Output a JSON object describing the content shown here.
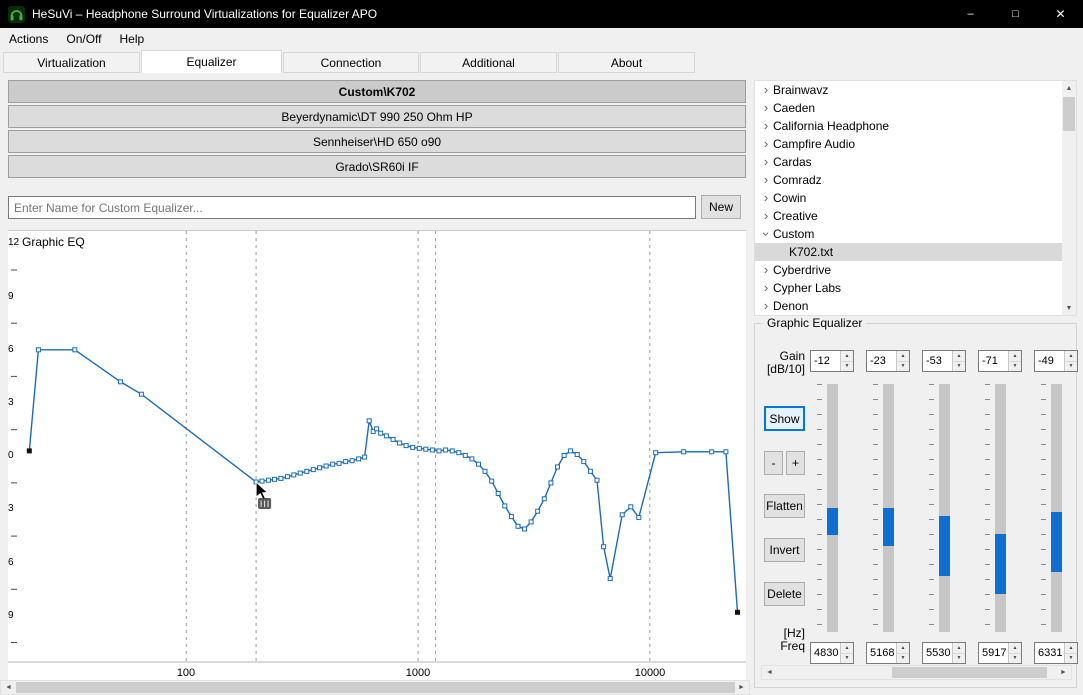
{
  "window": {
    "title": "HeSuVi – Headphone Surround Virtualizations for Equalizer APO"
  },
  "titlebar_controls": {
    "minimize": "–",
    "maximize": "□",
    "close": "✕"
  },
  "menu": [
    "Actions",
    "On/Off",
    "Help"
  ],
  "tabs": [
    "Virtualization",
    "Equalizer",
    "Connection",
    "Additional",
    "About"
  ],
  "active_tab": "Equalizer",
  "presets": [
    "Custom\\K702",
    "Beyerdynamic\\DT 990 250 Ohm HP",
    "Sennheiser\\HD 650 o90",
    "Grado\\SR60i IF"
  ],
  "selected_preset": "Custom\\K702",
  "name_input": {
    "placeholder": "Enter Name for Custom Equalizer...",
    "value": ""
  },
  "new_button_label": "New",
  "chart_data": {
    "type": "line",
    "title": "Graphic EQ",
    "x_scale": "log",
    "x_range_hz": [
      17,
      26000
    ],
    "y_range_db": [
      -11.6,
      12.7
    ],
    "x_ticks_hz": [
      100,
      1000,
      10000
    ],
    "x_tick_labels": [
      "100",
      "1000",
      "10000"
    ],
    "y_ticks_db": [
      12,
      9,
      6,
      3,
      0,
      -3,
      -6,
      -9
    ],
    "y_tick_labels_visible": [
      "12",
      "9",
      "6",
      "3",
      "0",
      "3",
      "6",
      "9"
    ],
    "grid_lines_hz": [
      100,
      200,
      1000,
      1190,
      10000
    ],
    "line_color": "#1b6cb5",
    "cursor_at": {
      "hz": 200,
      "db": -1.45
    },
    "series": [
      {
        "name": "EQ response (dB vs Hz)",
        "points": [
          [
            21,
            0.3
          ],
          [
            23,
            6
          ],
          [
            33,
            6
          ],
          [
            52,
            4.2
          ],
          [
            64,
            3.5
          ],
          [
            200,
            -1.45
          ],
          [
            212,
            -1.4
          ],
          [
            226,
            -1.35
          ],
          [
            240,
            -1.3
          ],
          [
            256,
            -1.25
          ],
          [
            273,
            -1.15
          ],
          [
            291,
            -1.05
          ],
          [
            310,
            -0.95
          ],
          [
            331,
            -0.85
          ],
          [
            353,
            -0.75
          ],
          [
            376,
            -0.65
          ],
          [
            401,
            -0.55
          ],
          [
            428,
            -0.45
          ],
          [
            456,
            -0.4
          ],
          [
            487,
            -0.3
          ],
          [
            519,
            -0.25
          ],
          [
            554,
            -0.15
          ],
          [
            588,
            -0.05
          ],
          [
            615,
            2
          ],
          [
            640,
            1.4
          ],
          [
            662,
            1.55
          ],
          [
            690,
            1.3
          ],
          [
            730,
            1.15
          ],
          [
            780,
            0.95
          ],
          [
            832,
            0.75
          ],
          [
            888,
            0.6
          ],
          [
            948,
            0.5
          ],
          [
            1012,
            0.45
          ],
          [
            1080,
            0.4
          ],
          [
            1153,
            0.35
          ],
          [
            1231,
            0.3
          ],
          [
            1314,
            0.35
          ],
          [
            1403,
            0.3
          ],
          [
            1498,
            0.2
          ],
          [
            1599,
            0.05
          ],
          [
            1707,
            -0.15
          ],
          [
            1822,
            -0.45
          ],
          [
            1945,
            -0.85
          ],
          [
            2077,
            -1.4
          ],
          [
            2217,
            -2.1
          ],
          [
            2367,
            -2.8
          ],
          [
            2527,
            -3.4
          ],
          [
            2698,
            -3.95
          ],
          [
            2880,
            -4.1
          ],
          [
            3075,
            -3.7
          ],
          [
            3283,
            -3.1
          ],
          [
            3505,
            -2.4
          ],
          [
            3742,
            -1.5
          ],
          [
            3995,
            -0.6
          ],
          [
            4265,
            0.05
          ],
          [
            4553,
            0.3
          ],
          [
            4861,
            0.1
          ],
          [
            5189,
            -0.3
          ],
          [
            5540,
            -0.85
          ],
          [
            5915,
            -1.35
          ],
          [
            6315,
            -5.1
          ],
          [
            6742,
            -6.9
          ],
          [
            7600,
            -3.3
          ],
          [
            8280,
            -2.85
          ],
          [
            8960,
            -3.45
          ],
          [
            10600,
            0.2
          ],
          [
            14000,
            0.25
          ],
          [
            18500,
            0.25
          ],
          [
            21300,
            0.25
          ],
          [
            23900,
            -8.8
          ]
        ]
      }
    ]
  },
  "tree": {
    "items": [
      {
        "label": "Brainwavz",
        "state": "collapsed",
        "level": 0
      },
      {
        "label": "Caeden",
        "state": "collapsed",
        "level": 0
      },
      {
        "label": "California Headphone",
        "state": "collapsed",
        "level": 0
      },
      {
        "label": "Campfire Audio",
        "state": "collapsed",
        "level": 0
      },
      {
        "label": "Cardas",
        "state": "collapsed",
        "level": 0
      },
      {
        "label": "Comradz",
        "state": "collapsed",
        "level": 0
      },
      {
        "label": "Cowin",
        "state": "collapsed",
        "level": 0
      },
      {
        "label": "Creative",
        "state": "collapsed",
        "level": 0
      },
      {
        "label": "Custom",
        "state": "expanded",
        "level": 0
      },
      {
        "label": "K702.txt",
        "state": "leaf",
        "level": 1,
        "selected": true
      },
      {
        "label": "Cyberdrive",
        "state": "collapsed",
        "level": 0
      },
      {
        "label": "Cypher Labs",
        "state": "collapsed",
        "level": 0
      },
      {
        "label": "Denon",
        "state": "collapsed",
        "level": 0
      }
    ]
  },
  "equalizer": {
    "group_title": "Graphic Equalizer",
    "gain_label_line1": "Gain",
    "gain_label_line2": "[dB/10]",
    "freq_label_line1": "[Hz]",
    "freq_label_line2": "Freq",
    "gains": [
      -12,
      -23,
      -53,
      -71,
      -49
    ],
    "freqs": [
      4830,
      5168,
      5530,
      5917,
      6331
    ],
    "buttons": {
      "show": "Show",
      "decrease": "-",
      "increase": "+",
      "flatten": "Flatten",
      "invert": "Invert",
      "delete": "Delete"
    },
    "slider_fill_color": "#0f6fd0"
  },
  "icons": {
    "app": "headphones-icon",
    "spin_up": "▲",
    "spin_down": "▼",
    "scroll_left": "◄",
    "scroll_right": "►",
    "scroll_up": "▲",
    "scroll_down": "▼",
    "chevron_collapsed": "›",
    "chevron_expanded": "›"
  }
}
